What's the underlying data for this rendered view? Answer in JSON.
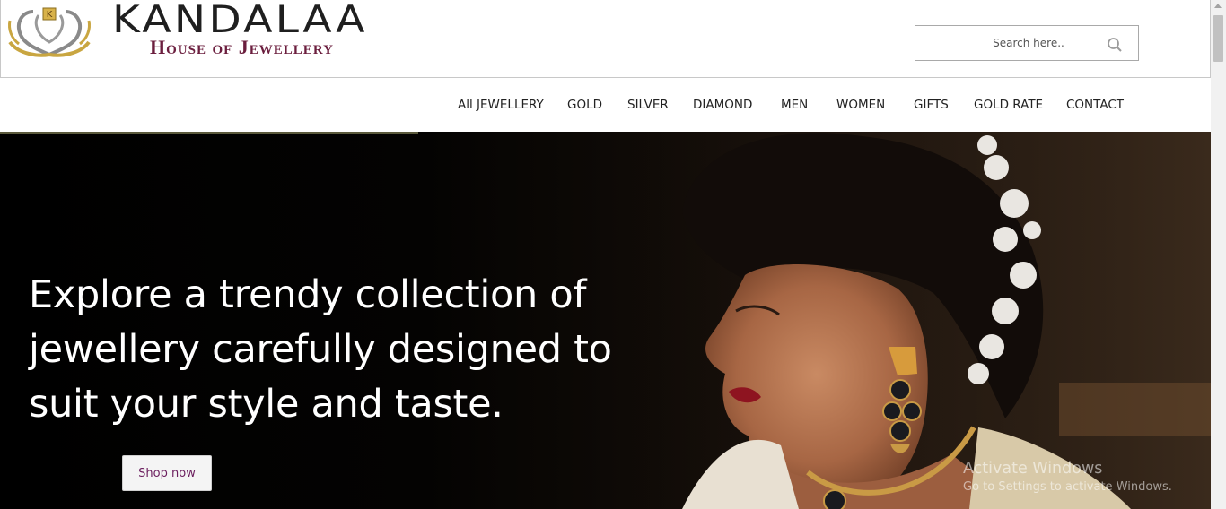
{
  "brand": {
    "name": "KANDALAA",
    "tagline": "House of Jewellery",
    "logo_letter": "K",
    "accent_gold": "#d8b24a",
    "accent_maroon": "#6b1e3e"
  },
  "search": {
    "placeholder": "Search here..",
    "icon": "search-icon"
  },
  "nav": {
    "items": [
      {
        "label": "All JEWELLERY"
      },
      {
        "label": "GOLD"
      },
      {
        "label": "SILVER"
      },
      {
        "label": "DIAMOND"
      },
      {
        "label": "MEN"
      },
      {
        "label": "WOMEN"
      },
      {
        "label": "GIFTS"
      },
      {
        "label": "GOLD RATE"
      },
      {
        "label": "CONTACT"
      }
    ]
  },
  "hero": {
    "headline_lines": [
      "Explore a trendy collection of",
      "jewellery carefully designed to",
      "suit your style and taste."
    ],
    "cta_label": "Shop now"
  },
  "watermark": {
    "title": "Activate Windows",
    "subtitle": "Go to Settings to activate Windows."
  }
}
